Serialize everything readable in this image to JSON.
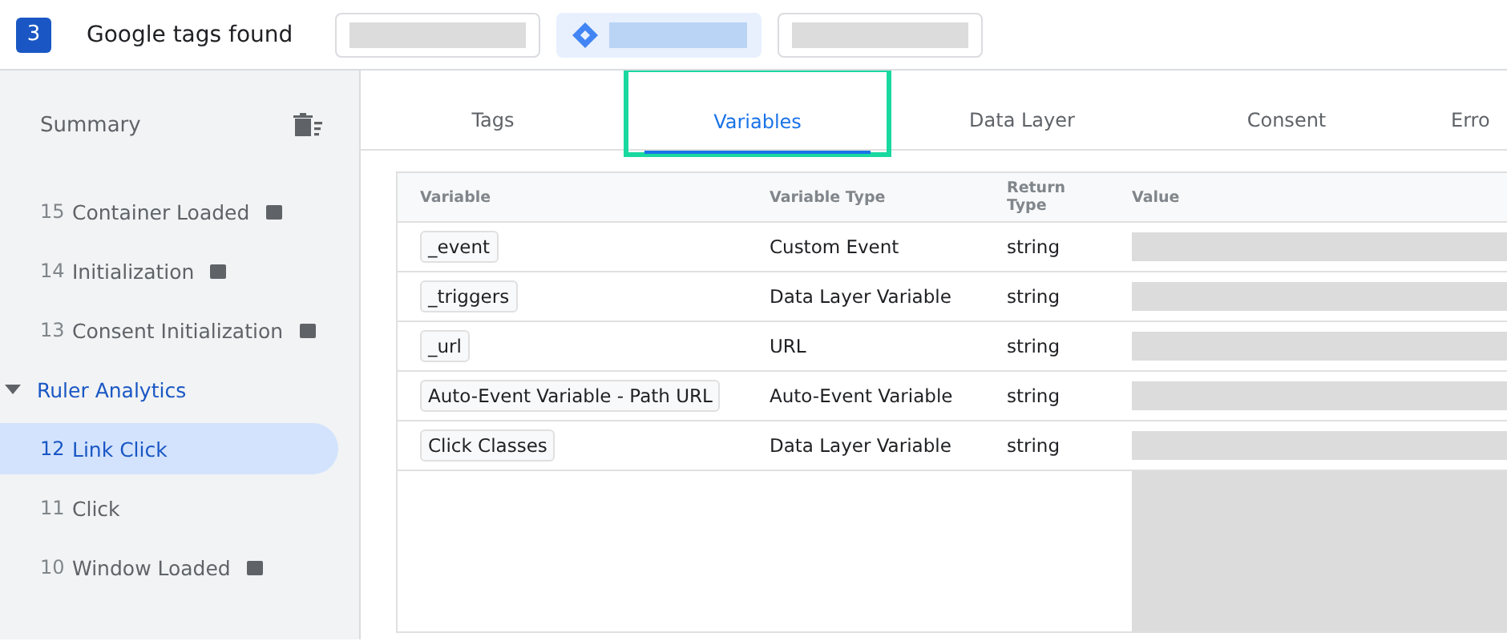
{
  "header": {
    "count": "3",
    "title": "Google tags found",
    "chips": [
      {
        "selected": false,
        "kind": "plain"
      },
      {
        "selected": true,
        "kind": "logo"
      },
      {
        "selected": false,
        "kind": "plain"
      }
    ]
  },
  "sidebar": {
    "title": "Summary",
    "items": [
      {
        "kind": "event",
        "number": "15",
        "label": "Container Loaded",
        "code_badge": true,
        "selected": false
      },
      {
        "kind": "event",
        "number": "14",
        "label": "Initialization",
        "code_badge": true,
        "selected": false
      },
      {
        "kind": "event",
        "number": "13",
        "label": "Consent Initialization",
        "code_badge": true,
        "selected": false
      },
      {
        "kind": "group",
        "label": "Ruler Analytics",
        "expanded": true
      },
      {
        "kind": "event",
        "number": "12",
        "label": "Link Click",
        "code_badge": false,
        "selected": true
      },
      {
        "kind": "event",
        "number": "11",
        "label": "Click",
        "code_badge": false,
        "selected": false
      },
      {
        "kind": "event",
        "number": "10",
        "label": "Window Loaded",
        "code_badge": true,
        "selected": false
      }
    ]
  },
  "tabs": [
    {
      "label": "Tags",
      "selected": false,
      "highlighted": false
    },
    {
      "label": "Variables",
      "selected": true,
      "highlighted": true
    },
    {
      "label": "Data Layer",
      "selected": false,
      "highlighted": false
    },
    {
      "label": "Consent",
      "selected": false,
      "highlighted": false
    },
    {
      "label": "Erro",
      "selected": false,
      "highlighted": false
    }
  ],
  "table": {
    "columns": [
      "Variable",
      "Variable Type",
      "Return Type",
      "Value"
    ],
    "rows": [
      {
        "variable": "_event",
        "type": "Custom Event",
        "return_type": "string"
      },
      {
        "variable": "_triggers",
        "type": "Data Layer Variable",
        "return_type": "string"
      },
      {
        "variable": "_url",
        "type": "URL",
        "return_type": "string"
      },
      {
        "variable": "Auto-Event Variable - Path URL",
        "type": "Auto-Event Variable",
        "return_type": "string"
      },
      {
        "variable": "Click Classes",
        "type": "Data Layer Variable",
        "return_type": "string"
      }
    ]
  }
}
